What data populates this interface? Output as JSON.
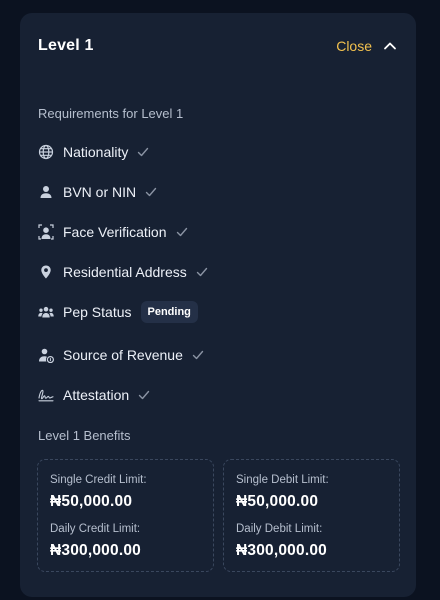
{
  "header": {
    "title": "Level 1",
    "toggle_label": "Close",
    "accent_color": "#f2c14e"
  },
  "requirements": {
    "heading": "Requirements for Level 1",
    "items": [
      {
        "label": "Nationality",
        "icon": "globe-icon",
        "status": "check"
      },
      {
        "label": "BVN or NIN",
        "icon": "person-icon",
        "status": "check"
      },
      {
        "label": "Face Verification",
        "icon": "face-scan-icon",
        "status": "check"
      },
      {
        "label": "Residential Address",
        "icon": "location-pin-icon",
        "status": "check"
      },
      {
        "label": "Pep Status",
        "icon": "group-icon",
        "status": "badge",
        "badge": "Pending"
      },
      {
        "label": "Source of Revenue",
        "icon": "person-money-icon",
        "status": "check"
      },
      {
        "label": "Attestation",
        "icon": "signature-icon",
        "status": "check"
      }
    ]
  },
  "benefits": {
    "heading": "Level 1 Benefits",
    "credit": {
      "single_label": "Single Credit Limit:",
      "single_value": "₦50,000.00",
      "daily_label": "Daily Credit Limit:",
      "daily_value": "₦300,000.00"
    },
    "debit": {
      "single_label": "Single Debit Limit:",
      "single_value": "₦50,000.00",
      "daily_label": "Daily Debit Limit:",
      "daily_value": "₦300,000.00"
    }
  }
}
